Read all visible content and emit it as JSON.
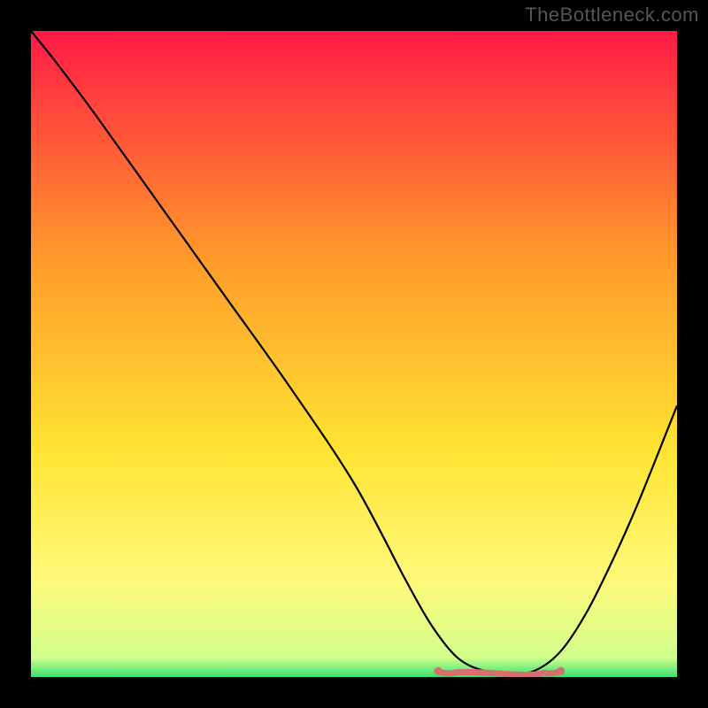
{
  "watermark": "TheBottleneck.com",
  "colors": {
    "frame_bg": "#000000",
    "grad_top": "#ff1a46",
    "grad_mid1": "#ff9a2a",
    "grad_mid2": "#ffe433",
    "grad_low": "#fff97a",
    "grad_green": "#38e070",
    "curve": "#000000",
    "highlight": "#d86f6f",
    "watermark": "#555555"
  },
  "chart_data": {
    "type": "line",
    "title": "",
    "xlabel": "",
    "ylabel": "",
    "xlim": [
      0,
      100
    ],
    "ylim": [
      0,
      100
    ],
    "series": [
      {
        "name": "bottleneck-curve",
        "x": [
          0,
          4,
          10,
          20,
          30,
          40,
          50,
          58,
          62,
          66,
          70,
          74,
          78,
          82,
          86,
          90,
          94,
          100
        ],
        "y": [
          100,
          95,
          87,
          73,
          59,
          45,
          30,
          15,
          8,
          3,
          1,
          0.5,
          1,
          4,
          10,
          18,
          27,
          42
        ]
      },
      {
        "name": "optimal-band",
        "x_range": [
          63,
          82
        ],
        "y": 0.8
      }
    ],
    "gradient_stops": [
      {
        "offset": 0.0,
        "color": "#ff1a46"
      },
      {
        "offset": 0.35,
        "color": "#ff9a2a"
      },
      {
        "offset": 0.65,
        "color": "#ffe433"
      },
      {
        "offset": 0.85,
        "color": "#fff97a"
      },
      {
        "offset": 0.97,
        "color": "#d2ff8c"
      },
      {
        "offset": 1.0,
        "color": "#38e070"
      }
    ]
  }
}
